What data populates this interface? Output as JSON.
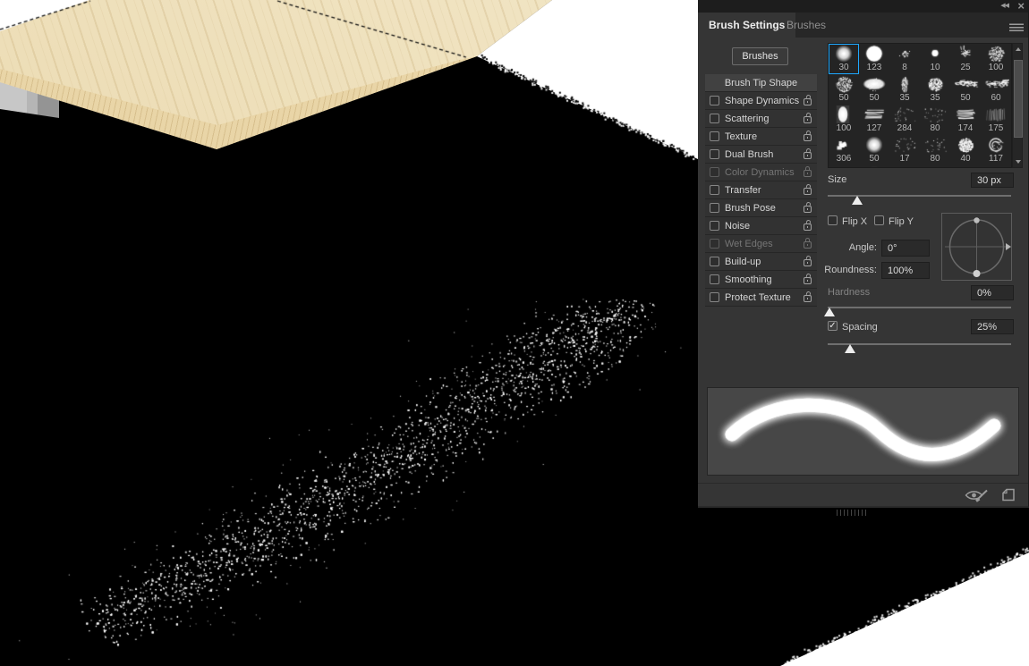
{
  "panel": {
    "window_icons": {
      "collapse_panel": "double-left-chevron",
      "close": "x"
    },
    "tabs": [
      {
        "label": "Brush Settings",
        "active": true
      },
      {
        "label": "Brushes",
        "active": false
      }
    ],
    "menu_icon": "hamburger",
    "brushes_button": "Brushes",
    "sections": [
      {
        "label": "Brush Tip Shape",
        "selected": true
      },
      {
        "label": "Shape Dynamics",
        "checked": false,
        "lock": "open",
        "disabled": false
      },
      {
        "label": "Scattering",
        "checked": false,
        "lock": "open",
        "disabled": false
      },
      {
        "label": "Texture",
        "checked": false,
        "lock": "open",
        "disabled": false
      },
      {
        "label": "Dual Brush",
        "checked": false,
        "lock": "open",
        "disabled": false
      },
      {
        "label": "Color Dynamics",
        "checked": false,
        "lock": "closed",
        "disabled": true
      },
      {
        "label": "Transfer",
        "checked": false,
        "lock": "open",
        "disabled": false
      },
      {
        "label": "Brush Pose",
        "checked": false,
        "lock": "open",
        "disabled": false
      },
      {
        "label": "Noise",
        "checked": false,
        "lock": "open",
        "disabled": false
      },
      {
        "label": "Wet Edges",
        "checked": false,
        "lock": "closed",
        "disabled": true
      },
      {
        "label": "Build-up",
        "checked": false,
        "lock": "open",
        "disabled": false
      },
      {
        "label": "Smoothing",
        "checked": false,
        "lock": "open",
        "disabled": false
      },
      {
        "label": "Protect Texture",
        "checked": false,
        "lock": "open",
        "disabled": false
      }
    ],
    "presets": {
      "selected_index": 0,
      "items": [
        {
          "n": "30",
          "s": "soft"
        },
        {
          "n": "123",
          "s": "hard"
        },
        {
          "n": "8",
          "s": "scatter-tiny"
        },
        {
          "n": "10",
          "s": "dot"
        },
        {
          "n": "25",
          "s": "chalk"
        },
        {
          "n": "100",
          "s": "stipple"
        },
        {
          "n": "50",
          "s": "stipple"
        },
        {
          "n": "50",
          "s": "ellipse"
        },
        {
          "n": "35",
          "s": "vstreak"
        },
        {
          "n": "35",
          "s": "blob"
        },
        {
          "n": "50",
          "s": "scatter"
        },
        {
          "n": "60",
          "s": "scatter"
        },
        {
          "n": "100",
          "s": "voval"
        },
        {
          "n": "127",
          "s": "hscratch"
        },
        {
          "n": "284",
          "s": "sparse"
        },
        {
          "n": "80",
          "s": "sparse"
        },
        {
          "n": "174",
          "s": "hscratch"
        },
        {
          "n": "175",
          "s": "fibers"
        },
        {
          "n": "306",
          "s": "chunks"
        },
        {
          "n": "50",
          "s": "soft"
        },
        {
          "n": "17",
          "s": "sparse"
        },
        {
          "n": "80",
          "s": "sparse"
        },
        {
          "n": "40",
          "s": "dense"
        },
        {
          "n": "117",
          "s": "swirl"
        }
      ]
    },
    "controls": {
      "size": {
        "label": "Size",
        "value": "30 px",
        "slider_pos": 0.161
      },
      "flip_x": "Flip X",
      "flip_y": "Flip Y",
      "angle": {
        "label": "Angle:",
        "value": "0°"
      },
      "roundness": {
        "label": "Roundness:",
        "value": "100%"
      },
      "hardness": {
        "label": "Hardness",
        "value": "0%",
        "slider_pos": 0.01,
        "disabled": true
      },
      "spacing": {
        "label": "Spacing",
        "value": "25%",
        "checked": true,
        "slider_pos": 0.122
      }
    },
    "footer_icons": [
      "brush-stroke-preview-eye",
      "create-new-brush"
    ],
    "accent_color": "#1ea8ff"
  }
}
